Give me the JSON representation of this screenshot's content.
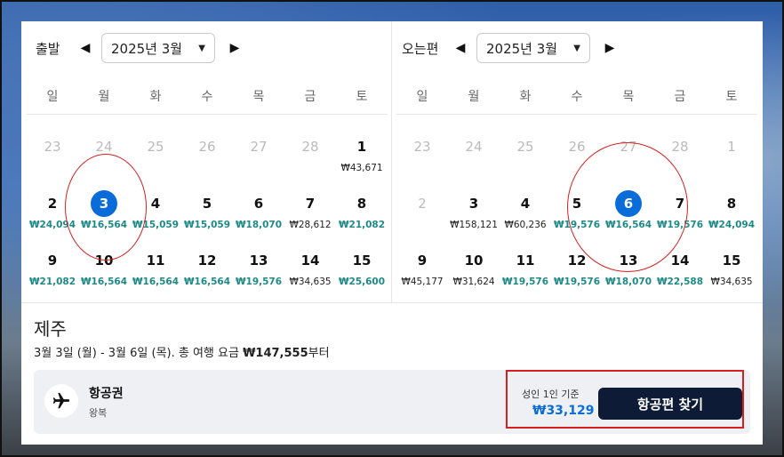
{
  "departure": {
    "title": "출발",
    "month": "2025년 3월",
    "weekdays": [
      "일",
      "월",
      "화",
      "수",
      "목",
      "금",
      "토"
    ],
    "weeks": [
      [
        {
          "d": "23",
          "p": "",
          "out": true
        },
        {
          "d": "24",
          "p": "",
          "out": true
        },
        {
          "d": "25",
          "p": "",
          "out": true
        },
        {
          "d": "26",
          "p": "",
          "out": true
        },
        {
          "d": "27",
          "p": "",
          "out": true
        },
        {
          "d": "28",
          "p": "",
          "out": true
        },
        {
          "d": "1",
          "p": "₩43,671"
        }
      ],
      [
        {
          "d": "2",
          "p": "₩24,094",
          "cheap": true
        },
        {
          "d": "3",
          "p": "₩16,564",
          "cheap": true,
          "sel": true
        },
        {
          "d": "4",
          "p": "₩15,059",
          "cheap": true
        },
        {
          "d": "5",
          "p": "₩15,059",
          "cheap": true
        },
        {
          "d": "6",
          "p": "₩18,070",
          "cheap": true
        },
        {
          "d": "7",
          "p": "₩28,612"
        },
        {
          "d": "8",
          "p": "₩21,082",
          "cheap": true
        }
      ],
      [
        {
          "d": "9",
          "p": "₩21,082",
          "cheap": true
        },
        {
          "d": "10",
          "p": "₩16,564",
          "cheap": true
        },
        {
          "d": "11",
          "p": "₩16,564",
          "cheap": true
        },
        {
          "d": "12",
          "p": "₩16,564",
          "cheap": true
        },
        {
          "d": "13",
          "p": "₩19,576",
          "cheap": true
        },
        {
          "d": "14",
          "p": "₩34,635"
        },
        {
          "d": "15",
          "p": "₩25,600",
          "cheap": true
        }
      ]
    ]
  },
  "return": {
    "title": "오는편",
    "month": "2025년 3월",
    "weekdays": [
      "일",
      "월",
      "화",
      "수",
      "목",
      "금",
      "토"
    ],
    "weeks": [
      [
        {
          "d": "23",
          "p": "",
          "out": true
        },
        {
          "d": "24",
          "p": "",
          "out": true
        },
        {
          "d": "25",
          "p": "",
          "out": true
        },
        {
          "d": "26",
          "p": "",
          "out": true
        },
        {
          "d": "27",
          "p": "",
          "out": true
        },
        {
          "d": "28",
          "p": "",
          "out": true
        },
        {
          "d": "1",
          "p": "",
          "out": true
        }
      ],
      [
        {
          "d": "2",
          "p": "",
          "out": true
        },
        {
          "d": "3",
          "p": "₩158,121"
        },
        {
          "d": "4",
          "p": "₩60,236"
        },
        {
          "d": "5",
          "p": "₩19,576",
          "cheap": true
        },
        {
          "d": "6",
          "p": "₩16,564",
          "cheap": true,
          "sel": true
        },
        {
          "d": "7",
          "p": "₩19,576",
          "cheap": true
        },
        {
          "d": "8",
          "p": "₩24,094",
          "cheap": true
        }
      ],
      [
        {
          "d": "9",
          "p": "₩45,177"
        },
        {
          "d": "10",
          "p": "₩31,624"
        },
        {
          "d": "11",
          "p": "₩19,576",
          "cheap": true
        },
        {
          "d": "12",
          "p": "₩19,576",
          "cheap": true
        },
        {
          "d": "13",
          "p": "₩18,070",
          "cheap": true
        },
        {
          "d": "14",
          "p": "₩22,588",
          "cheap": true
        },
        {
          "d": "15",
          "p": "₩34,635"
        }
      ]
    ]
  },
  "summary": {
    "destination": "제주",
    "dates": "3월 3일 (월) - 3월 6일 (목). 총 여행 요금 ",
    "total": "₩147,555",
    "suffix": "부터"
  },
  "flight": {
    "title": "항공권",
    "subtitle": "왕복",
    "basis": "성인 1인 기준",
    "fare": "₩33,129",
    "button": "항공편 찾기"
  },
  "colors": {
    "selected": "#0a6cd8",
    "cheap_price": "#1e8a86",
    "button": "#0d1b36",
    "annotation": "#d42020"
  },
  "icons": {
    "prev": "caret-left-icon",
    "next": "caret-right-icon",
    "dropdown": "caret-down-icon",
    "flight": "airplane-icon"
  }
}
